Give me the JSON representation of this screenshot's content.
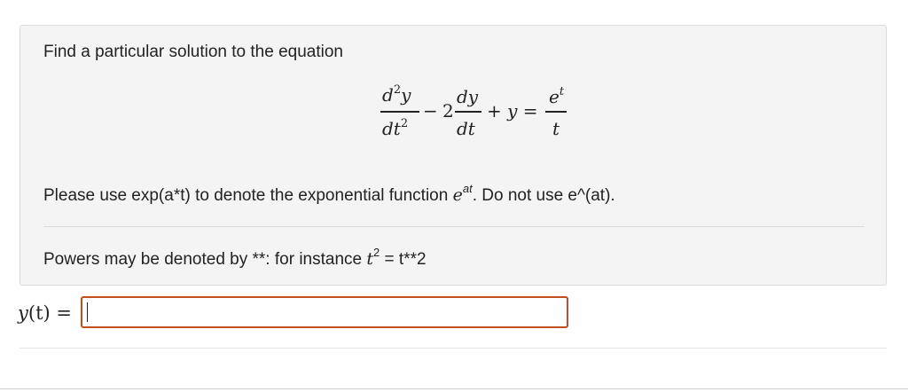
{
  "question": {
    "prompt": "Find a particular solution to the equation",
    "equation": {
      "term1_num": "d",
      "term1_num_sup": "2",
      "term1_num_var": "y",
      "term1_den": "dt",
      "term1_den_sup": "2",
      "minus": "−",
      "coef": "2",
      "term2_num": "dy",
      "term2_den": "dt",
      "plus_y": "+ y =",
      "rhs_num": "e",
      "rhs_num_sup": "t",
      "rhs_den": "t"
    },
    "note_prefix": "Please use exp(a*t) to denote the exponential function ",
    "note_math": "e",
    "note_math_sup": "at",
    "note_suffix": ". Do not use e^(at).",
    "powers_prefix": "Powers may be denoted by **: for instance ",
    "powers_math": "t",
    "powers_math_sup": "2",
    "powers_suffix": " = t**2"
  },
  "answer": {
    "label_fn": "y",
    "label_arg": "(t) =",
    "value": ""
  }
}
